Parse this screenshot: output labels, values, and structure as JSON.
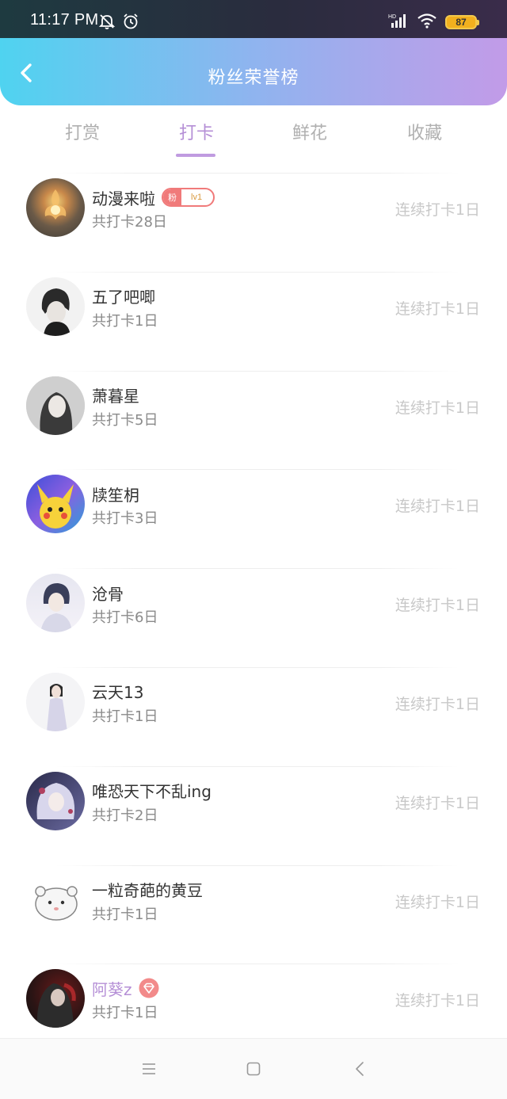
{
  "status_bar": {
    "time": "11:17 PM",
    "battery": "87",
    "icons": [
      "mute-bell-icon",
      "alarm-icon",
      "hd-signal-icon",
      "wifi-icon",
      "battery-icon"
    ]
  },
  "header": {
    "title": "粉丝荣誉榜",
    "back_icon": "chevron-left-icon"
  },
  "tabs": [
    {
      "label": "打赏",
      "active": false
    },
    {
      "label": "打卡",
      "active": true
    },
    {
      "label": "鲜花",
      "active": false
    },
    {
      "label": "收藏",
      "active": false
    }
  ],
  "fans": [
    {
      "name": "动漫来啦",
      "total": "共打卡28日",
      "streak": "连续打卡1日",
      "badge": {
        "label": "粉",
        "level": "lv1"
      }
    },
    {
      "name": "五了吧唧",
      "total": "共打卡1日",
      "streak": "连续打卡1日"
    },
    {
      "name": "萧暮星",
      "total": "共打卡5日",
      "streak": "连续打卡1日"
    },
    {
      "name": "牍笙枂",
      "total": "共打卡3日",
      "streak": "连续打卡1日"
    },
    {
      "name": "沧骨",
      "total": "共打卡6日",
      "streak": "连续打卡1日"
    },
    {
      "name": "云天13",
      "total": "共打卡1日",
      "streak": "连续打卡1日"
    },
    {
      "name": "唯恐天下不乱ing",
      "total": "共打卡2日",
      "streak": "连续打卡1日"
    },
    {
      "name": "一粒奇葩的黄豆",
      "total": "共打卡1日",
      "streak": "连续打卡1日"
    },
    {
      "name": "阿葵z",
      "total": "共打卡1日",
      "streak": "连续打卡1日",
      "vip": true
    }
  ],
  "colors": {
    "accent": "#b58fd6",
    "header_start": "#4fd3f0",
    "header_end": "#c29be8",
    "badge": "#f07a7a"
  },
  "nav_bar": {
    "icons": [
      "menu-icon",
      "home-square-icon",
      "back-triangle-icon"
    ]
  }
}
